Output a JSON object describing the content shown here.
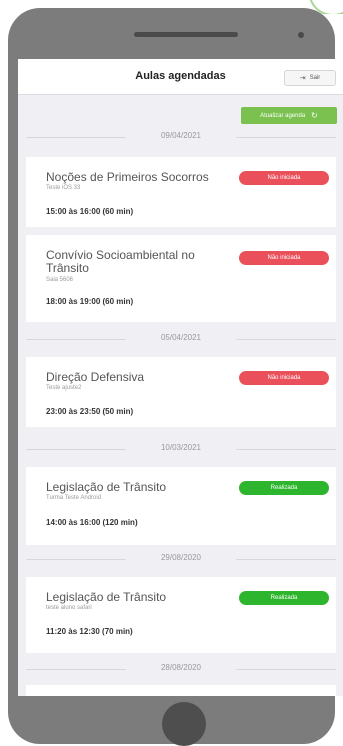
{
  "header": {
    "title": "Aulas agendadas",
    "exit_label": "Sair"
  },
  "actions": {
    "refresh_label": "Atualizar agenda"
  },
  "dates": [
    "09/04/2021",
    "05/04/2021",
    "10/03/2021",
    "29/08/2020",
    "28/08/2020"
  ],
  "lessons": [
    {
      "title": "Noções de Primeiros Socorros",
      "subtitle": "Teste iOS 33",
      "time": "15:00 às 16:00 (60 min)",
      "status": "Não iniciada"
    },
    {
      "title": "Convívio Socioambiental no Trânsito",
      "subtitle": "Sala 5606",
      "time": "18:00 às 19:00 (60 min)",
      "status": "Não iniciada"
    },
    {
      "title": "Direção Defensiva",
      "subtitle": "Teste ajuste2",
      "time": "23:00 às 23:50 (50 min)",
      "status": "Não iniciada"
    },
    {
      "title": "Legislação de Trânsito",
      "subtitle": "Turma Teste Android",
      "time": "14:00 às 16:00 (120 min)",
      "status": "Realizada"
    },
    {
      "title": "Legislação de Trânsito",
      "subtitle": "teste aluno safari",
      "time": "11:20 às 12:30 (70 min)",
      "status": "Realizada"
    }
  ],
  "colors": {
    "not_started": "#e9505a",
    "done": "#2eb52e",
    "accent": "#7ac14f"
  }
}
